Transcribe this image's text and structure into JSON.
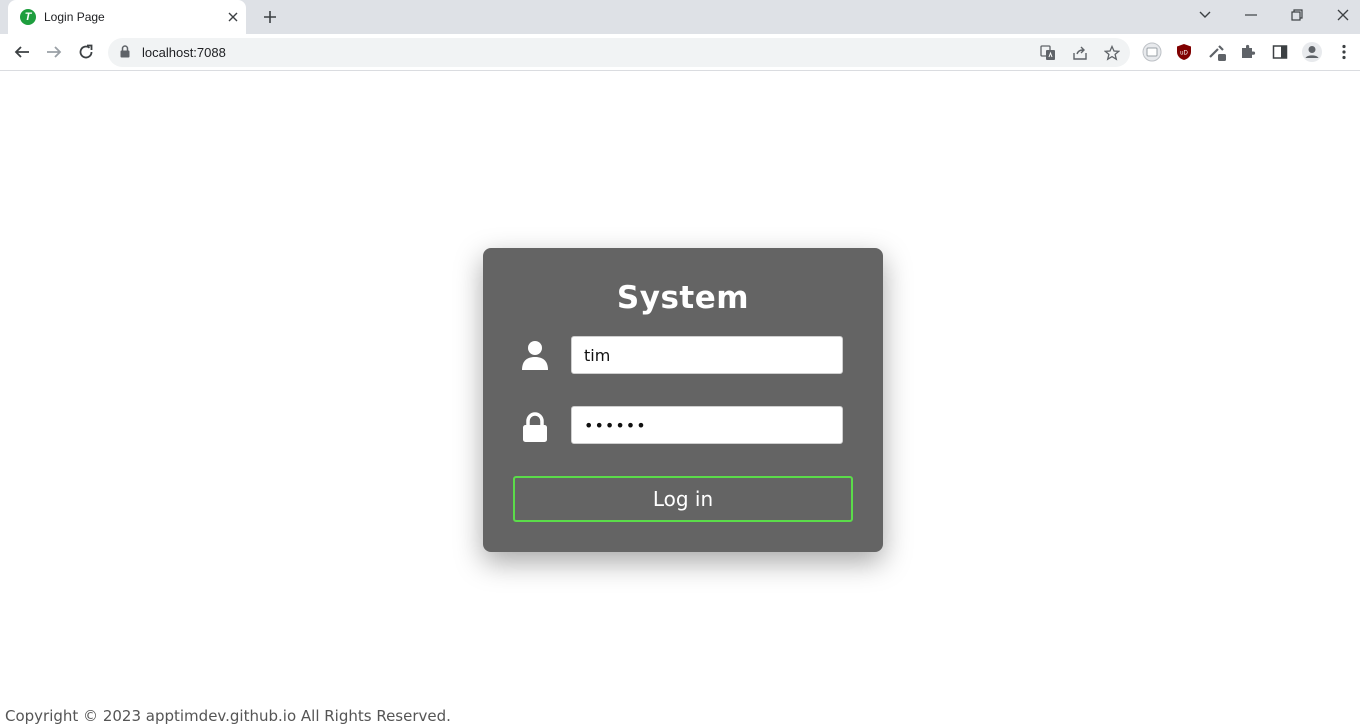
{
  "browser": {
    "tab_title": "Login Page",
    "favicon_letter": "T",
    "url": "localhost:7088",
    "icons": [
      "back-icon",
      "forward-icon",
      "reload-icon",
      "lock-icon",
      "translate-icon",
      "share-icon",
      "star-icon",
      "extension-icon",
      "ublock-icon",
      "eyedropper-icon",
      "puzzle-icon",
      "sidepanel-icon",
      "profile-icon",
      "kebab-menu-icon"
    ]
  },
  "login": {
    "title": "System",
    "username_value": "tim",
    "password_value": "••••••",
    "button_label": "Log in"
  },
  "footer": {
    "copyright": "Copyright © 2023 apptimdev.github.io All Rights Reserved."
  },
  "colors": {
    "card_bg": "#646464",
    "button_border": "#5bdc4a",
    "favicon_bg": "#1e9e3e"
  }
}
